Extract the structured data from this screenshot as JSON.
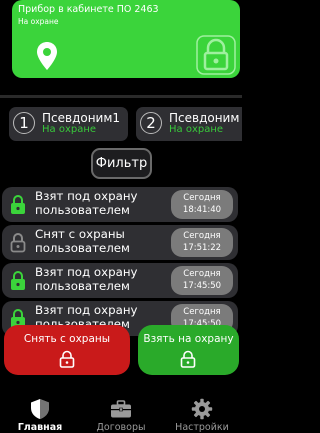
{
  "status": {
    "title": "Прибор в кабинете ПО 2463",
    "subtitle": "На охране",
    "color": "#3bd43b"
  },
  "aliases": [
    {
      "number": "1",
      "name": "Псевдоним1",
      "state": "На охране"
    },
    {
      "number": "2",
      "name": "Псевдоним",
      "state": "На охране"
    }
  ],
  "filter": {
    "label": "Фильтр"
  },
  "events": [
    {
      "text": "Взят под охрану пользователем",
      "day": "Сегодня",
      "time": "18:41:40",
      "lock_color": "#3bd43b"
    },
    {
      "text": "Снят с охраны пользователем",
      "day": "Сегодня",
      "time": "17:51:22",
      "lock_color": "#8a8a8a"
    },
    {
      "text": "Взят под охрану пользователем",
      "day": "Сегодня",
      "time": "17:45:50",
      "lock_color": "#3bd43b"
    },
    {
      "text": "Взят под охрану пользователем",
      "day": "Сегодня",
      "time": "17:45:50",
      "lock_color": "#3bd43b"
    }
  ],
  "actions": {
    "disarm_label": "Снять с охраны",
    "arm_label": "Взять на охрану",
    "disarm_color": "#c91a1a",
    "arm_color": "#2aaa2a"
  },
  "nav": [
    {
      "label": "Главная",
      "icon": "shield-icon",
      "active": true
    },
    {
      "label": "Договоры",
      "icon": "briefcase-icon",
      "active": false
    },
    {
      "label": "Настройки",
      "icon": "gear-icon",
      "active": false
    }
  ]
}
